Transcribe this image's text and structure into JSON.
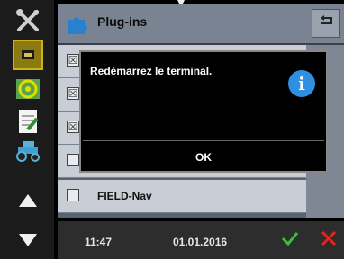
{
  "header": {
    "title": "Plug-ins"
  },
  "plugins": [
    {
      "label": "",
      "checked": true
    },
    {
      "label": "",
      "checked": true
    },
    {
      "label": "",
      "checked": true
    },
    {
      "label": "",
      "checked": false
    },
    {
      "label": "FIELD-Nav",
      "checked": false
    }
  ],
  "dialog": {
    "message": "Redémarrez le terminal.",
    "ok_label": "OK",
    "info_icon": "i"
  },
  "statusbar": {
    "time": "11:47",
    "date": "01.01.2016"
  },
  "colors": {
    "accent_ok": "#36c13a",
    "accent_cancel": "#e8211d",
    "info_blue": "#2f8fe0"
  }
}
